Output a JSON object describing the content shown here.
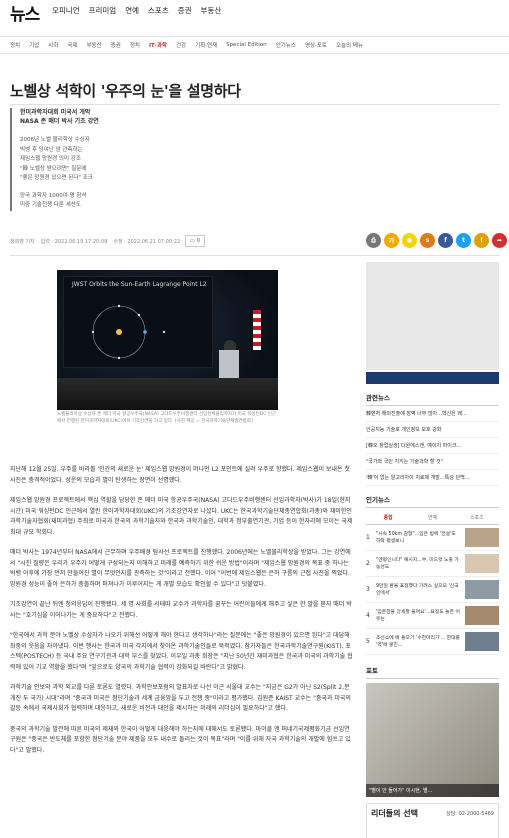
{
  "site": {
    "logo": "뉴스",
    "top_nav": [
      "오피니언",
      "프리미엄",
      "연예",
      "스포츠",
      "증권",
      "부동산"
    ]
  },
  "sections": {
    "items": [
      "정치",
      "기업",
      "사회",
      "국제",
      "부동산",
      "증권",
      "정치",
      "IT·과학",
      "건강",
      "기획·연재",
      "Special Edition",
      "인기뉴스",
      "영상·포토",
      "오늘의 메뉴"
    ],
    "active": "IT·과학"
  },
  "article": {
    "title": "노벨상 석학이 '우주의 눈'을 설명하다",
    "subtitles": [
      "한미과학자대회 미국서 개막",
      "NASA 존 매더 박사 기조 강연"
    ],
    "summary": [
      "2006년 노벨 물리학상 수상자",
      "빅뱅 후 잉여난 암 관측하는",
      "제임스웹 망원경 의미 강조",
      "\"韓 노벨상 받으려면\" 질문에",
      "\"좋은 망원경 있으면 된다\" 조크",
      "",
      "양국 과학자 1000여 명 참석",
      "미중 기술전쟁 다룬 세션도"
    ],
    "byline": "정희영 기자",
    "published": "입력 : 2022.06.19 17:20:09",
    "updated": "수정 : 2022.06.21 07:00:22",
    "comment_count": "0",
    "photo_title": "JWST Orbits the Sun-Earth Lagrange Point L2",
    "caption": "노벨물리학상 수상자 존 매더 미국 항공우주국(NASA) 고다드우주비행센터 선임천체물리학자가 미국 워싱턴DC 인근에서 진행된 한미과학자대회(UKC)에서 기조강연을 하고 있다. [사진 제공 = 한국과학기술단체총연합회]",
    "paragraphs": [
      "지난해 12월 25일. 우주를 바라볼 '인간의 새로운 눈' 제임스웹 망원경이 머나먼 L2 포인트에 실려 우주로 향했다. 제임스웹이 보내온 첫 사진은 충격적이었다. 성운의 모습과 별이 탄생하는 장면이 선명했다.",
      "제임스웹 망원경 프로젝트에서 핵심 역할을 담당한 존 매더 미국 항공우주국(NASA) 고다드우주비행센터 선임과학자(박사)가 18일(현지시간) 미국 워싱턴DC 인근에서 열린 한미과학자대회(UKC)의 기조강연자로 나섰다. UKC는 한국과학기술단체총연합회(과총)와 재미한인과학기술자협회(재미과협) 주최로 미국과 한국의 과학기술자와 한국과 과학기술인, 대학과 정부출연기관, 기업 등이 한자리에 모이는 국제 최대 규모 학회다.",
      "매더 박사는 1974년부터 NASA에서 근무하며 우주배경 탐사선 프로젝트를 진행했다. 2006년에는 노벨물리학상을 받았다. 그는 강연에서 \"시진 질량은 우리가 우주가 어떻게 구성되는지 이해하고 미래를 예측하기 위한 쉬운 방법\"이라며 \"제임스웹 망원경의 목표 중 하나는 빅뱅 이후에 가장 먼저 만들어진 별이 무엇인지를 관측하는 것\"이라고 전했다. 이어 \"이번에 제임스웹은 은하 구름의 근접 사진을 찍었다. 망원경 성능이 좋아 은하가 충돌하며 퍼져나가 이루어지는 게 개별 모습도 확인할 수 있다\"고 덧붙였다.",
      "기조강연이 끝난 뒤엔 청의응답이 진행됐다. 세 명 사회를 서태따 교수가 과학자를 꿈꾸는 어린이들에게 해주고 싶은 한 말을 묻자 매더 박사는 \"호기심을 이어나가는 게 중요하다\"고 전했다.",
      "\"한국에서 과학 분야 노벨상 수상자가 나오기 위해선 어떻게 해야 한다고 생각하나\"라는 질문에는 \"좋은 망원경이 있으면 된다\"고 대답해 좌중의 웃음을 자아냈다. 이번 행사는 한국과 미국 각지에서 찾아온 과학기술인들로 북적였다. 참가자들은 한국과학기술연구원(KIST), 포스텍(POSTECH) 등 국내 주요 연구기관과 대학 부스를 찾았다. 이우일 과총 회장은 \"지난 50년간 재미과협은 한국과 미국의 과학기술 협력에 있어 기교 역할을 했다\"며 \"앞으로도 양국의 과학기술 협력이 강화되길 바란다\"고 밝혔다.",
      "과학기술 안보와 과학 외교를 다룬 토론도 열렸다. 과학안보포럼의 발표자로 나선 이근 서울대 교수는 \"지금은 G2가 아닌 S2(Split 2,분개진 두 국가) 시대\"라며 \"중국과 미국은 첨단기술과 세계 금융망을 두고 전쟁 중\"이라고 평가했다. 김원준 KAIST 교수는 \"중국과 미국의 갈등 속에서 국제사회가 협력하며 대응하고, 새로운 비전과 대안을 제시하는 미래의 리더십이 필요하다\"고 했다.",
      "중국의 과학기술 발전에 따른 미국의 제재와 한국이 어떻게 대응해야 하는지에 대해서도 토론됐다. 마이클 앤 퍼네기국제평화기금 선임연구원은 \"중국은 반도체를 포함한 첨단기술 분야 제품을 모두 내수로 돌리는 것이 목표\"라며 \"이를 위해 자국 과학기술의 개발에 힘쓰고 있다\"고 말했다."
    ]
  },
  "sidebar": {
    "related_title": "관련뉴스",
    "related": [
      "韓벤처 해외진출에 장벽 너무 많아...혁신은 왜...",
      "인공지능 기술로 개인정보 보호 강화",
      "[韓오 창업실생] 다원에스앤, 예이지 마이크...",
      "\"국가와 국민 지키는 기술과학 할 것\"",
      "'韓'이 없는 알고리아이 치료제 개발...특성 단백..."
    ],
    "popular_title": "인기뉴스",
    "tabs": [
      "종합",
      "연예",
      "스포츠"
    ],
    "popular": [
      {
        "num": "1",
        "text": "\"시속 50km 감형\"...입은 밤에 '전설'도 하락 평생보니"
      },
      {
        "num": "2",
        "text": "\"엔평인니다\" 예시지...쑤, 미드컷 노출 가능성도"
      },
      {
        "num": "3",
        "text": "9만원 환율 표정했다 가려스 싶으오 '신국 안에서'"
      },
      {
        "num": "4",
        "text": "'임운한물 강세할 물여요'...표정도 늘은 어유는"
      },
      {
        "num": "5",
        "text": "조선소에 배 들으기 '수천마리가'... 한대를 '역'에 뭉친..."
      }
    ],
    "photo_title": "포토",
    "photo_caption": "\"별이 안 들어가\" 이시현, 별...",
    "ad_title": "리더들의 선택",
    "ad_phone": "상담: 02-2000-5469"
  }
}
